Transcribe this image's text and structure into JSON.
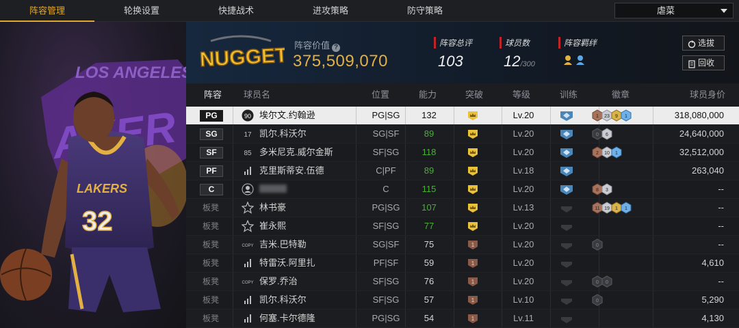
{
  "nav": {
    "tabs": [
      "阵容管理",
      "轮换设置",
      "快捷战术",
      "进攻策略",
      "防守策略"
    ],
    "active_tab": "阵容管理",
    "dropdown_value": "虐菜"
  },
  "header": {
    "team_logo_text": "NUGGETS",
    "lineup_value_label": "阵容价值",
    "lineup_value": "375,509,070",
    "rating_label": "阵容总评",
    "rating_value": "103",
    "players_label": "球员数",
    "players_value": "12",
    "players_max": "/300",
    "bond_label": "阵容羁绊",
    "pick_button": "选拔",
    "back_button": "回收"
  },
  "columns": {
    "lineup": "阵容",
    "player_name": "球员名",
    "position": "位置",
    "ability": "能力",
    "breakthrough": "突破",
    "level": "等级",
    "training": "训练",
    "badges": "徽章",
    "value": "球员身价"
  },
  "colors": {
    "accent": "#e0a930",
    "value_gold": "#e3b043",
    "green": "#4caf3a",
    "red_marker": "#c0242b"
  },
  "rows": [
    {
      "slot": "PG",
      "number": "90",
      "pic_type": "jersey-circle",
      "name": "埃尔文.约翰逊",
      "pos": "PG|SG",
      "ability": "132",
      "ability_green": false,
      "crown": "gold",
      "level": "Lv.20",
      "train": "blue",
      "badges": [
        {
          "t": "bronze",
          "n": "1"
        },
        {
          "t": "silver",
          "n": "23"
        },
        {
          "t": "gold",
          "n": "9"
        },
        {
          "t": "blue",
          "n": "1"
        }
      ],
      "value": "318,080,000",
      "selected": true
    },
    {
      "slot": "SG",
      "number": "17",
      "pic_type": "jersey",
      "name": "凯尔.科沃尔",
      "pos": "SG|SF",
      "ability": "89",
      "ability_green": true,
      "crown": "gold",
      "level": "Lv.20",
      "train": "blue",
      "badges": [
        {
          "t": "dark",
          "n": "0"
        },
        {
          "t": "silver",
          "n": "6"
        }
      ],
      "value": "24,640,000"
    },
    {
      "slot": "SF",
      "number": "85",
      "pic_type": "jersey",
      "name": "多米尼克.威尔金斯",
      "pos": "SF|SG",
      "ability": "118",
      "ability_green": true,
      "crown": "gold",
      "level": "Lv.20",
      "train": "blue",
      "badges": [
        {
          "t": "bronze",
          "n": "2"
        },
        {
          "t": "silver",
          "n": "10"
        },
        {
          "t": "blue",
          "n": "1"
        }
      ],
      "value": "32,512,000"
    },
    {
      "slot": "PF",
      "number": "",
      "pic_type": "bars",
      "name": "克里斯蒂安.伍德",
      "pos": "C|PF",
      "ability": "89",
      "ability_green": true,
      "crown": "gold",
      "level": "Lv.18",
      "train": "blue",
      "badges": [],
      "value": "263,040"
    },
    {
      "slot": "C",
      "number": "",
      "pic_type": "person",
      "name": "",
      "name_hidden": true,
      "pos": "C",
      "ability": "115",
      "ability_green": true,
      "crown": "gold",
      "level": "Lv.20",
      "train": "blue",
      "badges": [
        {
          "t": "bronze",
          "n": "8"
        },
        {
          "t": "silver",
          "n": "3"
        }
      ],
      "value": "--"
    },
    {
      "slot": "板凳",
      "number": "",
      "pic_type": "star",
      "name": "林书豪",
      "pos": "PG|SG",
      "ability": "107",
      "ability_green": true,
      "crown": "gold",
      "level": "Lv.13",
      "train": "dark",
      "badges": [
        {
          "t": "bronze",
          "n": "11"
        },
        {
          "t": "silver",
          "n": "19"
        },
        {
          "t": "gold",
          "n": "1"
        },
        {
          "t": "blue",
          "n": "1"
        }
      ],
      "value": "--"
    },
    {
      "slot": "板凳",
      "number": "",
      "pic_type": "star",
      "name": "崔永熙",
      "pos": "SF|SG",
      "ability": "77",
      "ability_green": true,
      "crown": "gold",
      "level": "Lv.20",
      "train": "dark",
      "badges": [],
      "value": "--"
    },
    {
      "slot": "板凳",
      "number": "",
      "pic_type": "copy",
      "name": "吉米.巴特勒",
      "pos": "SG|SF",
      "ability": "75",
      "ability_green": false,
      "crown": "bronze",
      "crown_num": "1",
      "level": "Lv.20",
      "train": "dark",
      "badges": [
        {
          "t": "dark",
          "n": "0"
        }
      ],
      "value": "--"
    },
    {
      "slot": "板凳",
      "number": "",
      "pic_type": "bars",
      "name": "特雷沃.阿里扎",
      "pos": "PF|SF",
      "ability": "59",
      "ability_green": false,
      "crown": "bronze",
      "crown_num": "1",
      "level": "Lv.20",
      "train": "dark",
      "badges": [],
      "value": "4,610"
    },
    {
      "slot": "板凳",
      "number": "",
      "pic_type": "copy",
      "name": "保罗.乔治",
      "pos": "SF|SG",
      "ability": "76",
      "ability_green": false,
      "crown": "bronze",
      "crown_num": "1",
      "level": "Lv.20",
      "train": "dark",
      "badges": [
        {
          "t": "dark",
          "n": "0"
        },
        {
          "t": "dark",
          "n": "0"
        }
      ],
      "value": "--"
    },
    {
      "slot": "板凳",
      "number": "",
      "pic_type": "bars",
      "name": "凯尔.科沃尔",
      "pos": "SF|SG",
      "ability": "57",
      "ability_green": false,
      "crown": "bronze",
      "crown_num": "1",
      "level": "Lv.10",
      "train": "dark",
      "badges": [
        {
          "t": "dark",
          "n": "0"
        }
      ],
      "value": "5,290"
    },
    {
      "slot": "板凳",
      "number": "",
      "pic_type": "bars",
      "name": "何塞.卡尔德隆",
      "pos": "PG|SG",
      "ability": "54",
      "ability_green": false,
      "crown": "bronze",
      "crown_num": "1",
      "level": "Lv.11",
      "train": "dark",
      "badges": [],
      "value": "4,130"
    }
  ],
  "left_art": {
    "jersey_text": "LAKERS",
    "jersey_number": "32",
    "banner_text": "LOS ANGELES"
  }
}
